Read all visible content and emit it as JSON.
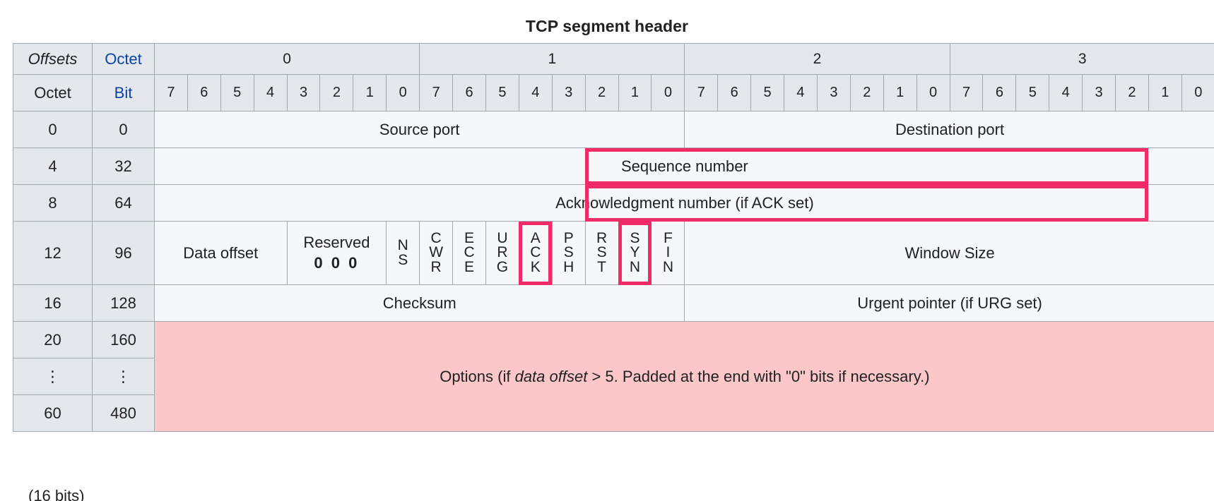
{
  "title": "TCP segment header",
  "colors": {
    "header_bg": "#e4e7ec",
    "field_bg": "#f6f7f9",
    "options_bg": "#fcc7c9",
    "grid_line": "#a2a9b1",
    "highlight": "#f02b68",
    "blue_text": "#0b43a8"
  },
  "header": {
    "offsets_label": "Offsets",
    "octet_label_top": "Octet",
    "octet_label_left": "Octet",
    "bit_label": "Bit",
    "octet_groups": [
      "0",
      "1",
      "2",
      "3"
    ],
    "bit_numbers": [
      "7",
      "6",
      "5",
      "4",
      "3",
      "2",
      "1",
      "0",
      "7",
      "6",
      "5",
      "4",
      "3",
      "2",
      "1",
      "0",
      "7",
      "6",
      "5",
      "4",
      "3",
      "2",
      "1",
      "0",
      "7",
      "6",
      "5",
      "4",
      "3",
      "2",
      "1",
      "0"
    ]
  },
  "rows": [
    {
      "octet": "0",
      "bit": "0",
      "fields": [
        {
          "label": "Source port",
          "bits": 16
        },
        {
          "label": "Destination port",
          "bits": 16
        }
      ]
    },
    {
      "octet": "4",
      "bit": "32",
      "fields": [
        {
          "label": "Sequence number",
          "bits": 32
        }
      ]
    },
    {
      "octet": "8",
      "bit": "64",
      "fields": [
        {
          "label": "Acknowledgment number (if ACK set)",
          "bits": 32
        }
      ]
    },
    {
      "octet": "12",
      "bit": "96",
      "fields": [
        {
          "label": "Data offset",
          "bits": 4
        },
        {
          "label": "Reserved",
          "sub": "0 0 0",
          "bits": 3
        },
        {
          "label": "NS",
          "bits": 1,
          "flag": true
        },
        {
          "label": "CWR",
          "bits": 1,
          "flag": true
        },
        {
          "label": "ECE",
          "bits": 1,
          "flag": true
        },
        {
          "label": "URG",
          "bits": 1,
          "flag": true
        },
        {
          "label": "ACK",
          "bits": 1,
          "flag": true
        },
        {
          "label": "PSH",
          "bits": 1,
          "flag": true
        },
        {
          "label": "RST",
          "bits": 1,
          "flag": true
        },
        {
          "label": "SYN",
          "bits": 1,
          "flag": true
        },
        {
          "label": "FIN",
          "bits": 1,
          "flag": true
        },
        {
          "label": "Window Size",
          "bits": 16
        }
      ]
    },
    {
      "octet": "16",
      "bit": "128",
      "fields": [
        {
          "label": "Checksum",
          "bits": 16
        },
        {
          "label": "Urgent pointer (if URG set)",
          "bits": 16
        }
      ]
    },
    {
      "octet": "20",
      "bit": "160",
      "options": true
    },
    {
      "octet": "⋮",
      "bit": "⋮",
      "options": true
    },
    {
      "octet": "60",
      "bit": "480",
      "options": true
    }
  ],
  "options": {
    "text_before": "Options (if ",
    "text_italic": "data offset",
    "text_after": " > 5. Padded at the end with \"0\" bits if necessary.)"
  },
  "highlights": [
    {
      "name": "sequence-number-highlight",
      "target": "Sequence number"
    },
    {
      "name": "acknowledgment-number-highlight",
      "target": "Acknowledgment number (if ACK set)"
    },
    {
      "name": "ack-flag-highlight",
      "target": "ACK"
    },
    {
      "name": "syn-flag-highlight",
      "target": "SYN"
    }
  ],
  "bottom_caption": "(16 bits)"
}
